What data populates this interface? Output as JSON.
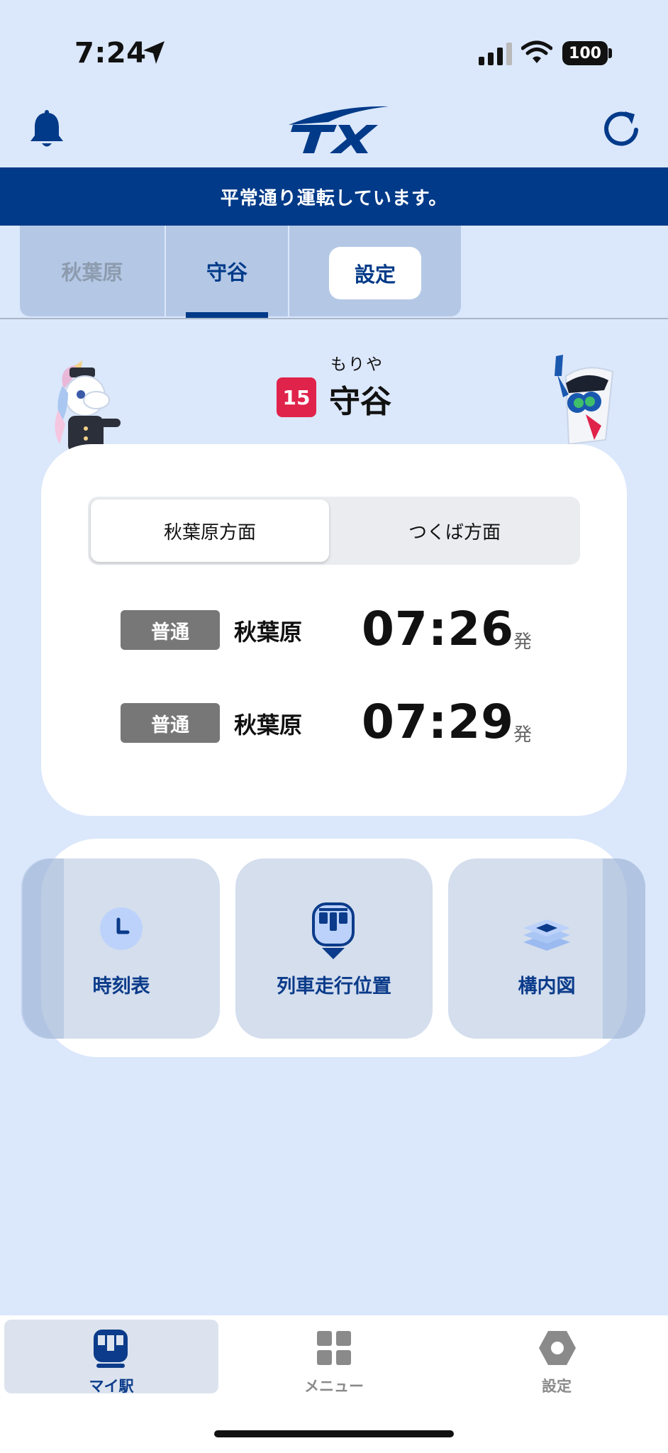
{
  "status_bar": {
    "time": "7:24",
    "battery": "100"
  },
  "banner": {
    "message": "平常通り運転しています。"
  },
  "station_tabs": [
    {
      "label": "秋葉原"
    },
    {
      "label": "守谷"
    },
    {
      "label": "設定"
    }
  ],
  "station": {
    "furigana": "もりや",
    "number": "15",
    "name": "守谷"
  },
  "direction": {
    "active": "秋葉原方面",
    "inactive": "つくば方面"
  },
  "departures": [
    {
      "type": "普通",
      "destination": "秋葉原",
      "time": "07:26",
      "suffix": "発"
    },
    {
      "type": "普通",
      "destination": "秋葉原",
      "time": "07:29",
      "suffix": "発"
    }
  ],
  "actions": [
    {
      "label": "時刻表",
      "icon": "clock-icon"
    },
    {
      "label": "列車走行位置",
      "icon": "train-position-icon"
    },
    {
      "label": "構内図",
      "icon": "layers-icon"
    }
  ],
  "bottom_nav": [
    {
      "label": "マイ駅",
      "icon": "train-icon"
    },
    {
      "label": "メニュー",
      "icon": "grid-icon"
    },
    {
      "label": "設定",
      "icon": "hexagon-icon"
    }
  ],
  "colors": {
    "brand": "#003a88",
    "background": "#dbe7fb",
    "station_number": "#e0234b",
    "train_type": "#777777"
  }
}
